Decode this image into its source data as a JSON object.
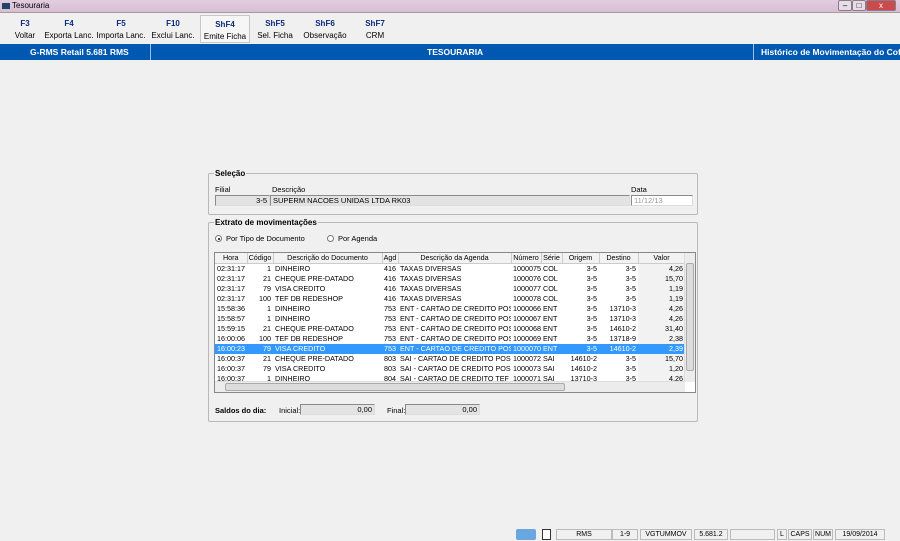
{
  "window": {
    "title": "Tesouraria",
    "minimize": "–",
    "restore": "□",
    "close": "x"
  },
  "toolbar": [
    {
      "key": "F3",
      "label": "Voltar"
    },
    {
      "key": "F4",
      "label": "Exporta Lanc."
    },
    {
      "key": "F5",
      "label": "Importa Lanc."
    },
    {
      "key": "F10",
      "label": "Exclui Lanc."
    },
    {
      "key": "ShF4",
      "label": "Emite Ficha"
    },
    {
      "key": "ShF5",
      "label": "Sel. Ficha"
    },
    {
      "key": "ShF6",
      "label": "Observação"
    },
    {
      "key": "ShF7",
      "label": "CRM"
    }
  ],
  "header": {
    "app": "G-RMS Retail 5.681 RMS",
    "module": "TESOURARIA",
    "screen": "Histórico de Movimentação do Cofre"
  },
  "selecao": {
    "title": "Seleção",
    "filial_label": "Filial",
    "filial": "3-5",
    "descricao_label": "Descrição",
    "descricao": "SUPERM NACOES UNIDAS LTDA RK03",
    "data_label": "Data",
    "data": "11/12/13"
  },
  "extrato": {
    "title": "Extrato de movimentações",
    "radio1": "Por Tipo de Documento",
    "radio2": "Por Agenda",
    "selected": "Por Tipo de Documento",
    "columns": [
      "Hora",
      "Código",
      "Descrição do Documento",
      "Agd",
      "Descrição da Agenda",
      "Número",
      "Série",
      "Origem",
      "Destino",
      "Valor"
    ],
    "rows": [
      [
        "02:31:17",
        "1",
        "DINHEIRO",
        "416",
        "TAXAS DIVERSAS",
        "1000075",
        "COL",
        "3-5",
        "3-5",
        "4,26"
      ],
      [
        "02:31:17",
        "21",
        "CHEQUE PRE-DATADO",
        "416",
        "TAXAS DIVERSAS",
        "1000076",
        "COL",
        "3-5",
        "3-5",
        "15,70"
      ],
      [
        "02:31:17",
        "79",
        "VISA CREDITO",
        "416",
        "TAXAS DIVERSAS",
        "1000077",
        "COL",
        "3-5",
        "3-5",
        "1,19"
      ],
      [
        "02:31:17",
        "100",
        "TEF DB REDESHOP",
        "416",
        "TAXAS DIVERSAS",
        "1000078",
        "COL",
        "3-5",
        "3-5",
        "1,19"
      ],
      [
        "15:58:36",
        "1",
        "DINHEIRO",
        "753",
        "ENT - CARTAO DE CREDITO POS",
        "1000066",
        "ENT",
        "3-5",
        "13710-3",
        "4,26"
      ],
      [
        "15:58:57",
        "1",
        "DINHEIRO",
        "753",
        "ENT - CARTAO DE CREDITO POS",
        "1000067",
        "ENT",
        "3-5",
        "13710-3",
        "4,26"
      ],
      [
        "15:59:15",
        "21",
        "CHEQUE PRE-DATADO",
        "753",
        "ENT - CARTAO DE CREDITO POS",
        "1000068",
        "ENT",
        "3-5",
        "14610-2",
        "31,40"
      ],
      [
        "16:00:06",
        "100",
        "TEF DB REDESHOP",
        "753",
        "ENT - CARTAO DE CREDITO POS",
        "1000069",
        "ENT",
        "3-5",
        "13718-9",
        "2,38"
      ],
      [
        "16:00:23",
        "79",
        "VISA CREDITO",
        "753",
        "ENT - CARTAO DE CREDITO POS",
        "1000070",
        "ENT",
        "3-5",
        "14610-2",
        "2,39"
      ],
      [
        "16:00:37",
        "21",
        "CHEQUE PRE-DATADO",
        "803",
        "SAI - CARTAO DE CREDITO POS",
        "1000072",
        "SAI",
        "14610-2",
        "3-5",
        "15,70"
      ],
      [
        "16:00:37",
        "79",
        "VISA CREDITO",
        "803",
        "SAI - CARTAO DE CREDITO POS",
        "1000073",
        "SAI",
        "14610-2",
        "3-5",
        "1,20"
      ],
      [
        "16:00:37",
        "1",
        "DINHEIRO",
        "804",
        "SAI - CARTAO DE CREDITO TEF",
        "1000071",
        "SAI",
        "13710-3",
        "3-5",
        "4,26"
      ]
    ],
    "selected_row": 8
  },
  "saldos": {
    "label": "Saldos do dia:",
    "inicial_label": "Inicial:",
    "inicial": "0,00",
    "final_label": "Final:",
    "final": "0,00"
  },
  "status": {
    "system": "RMS",
    "code": "1-9",
    "program": "VGTUMMOV",
    "version": "5.681.2",
    "l": "L",
    "caps": "CAPS",
    "num": "NUM",
    "date": "19/09/2014"
  },
  "colors": {
    "header_blue": "#0058b0",
    "selection": "#3399ff"
  }
}
